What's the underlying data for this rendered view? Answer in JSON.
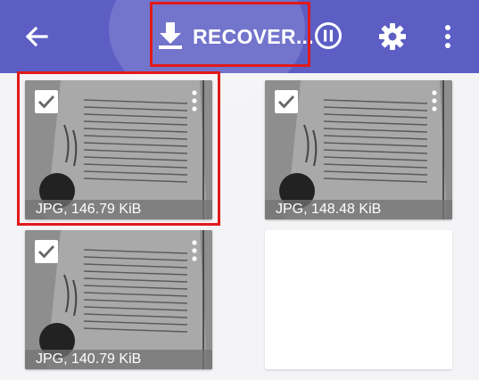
{
  "toolbar": {
    "recover_label": "RECOVER...",
    "icons": [
      "back-arrow-icon",
      "download-icon",
      "pause-icon",
      "settings-gear-icon",
      "more-vert-icon"
    ],
    "colors": {
      "background": "#5c5ec4",
      "highlight": "#e01a1a"
    }
  },
  "files": [
    {
      "caption": "JPG, 146.79 KiB",
      "selected": true
    },
    {
      "caption": "JPG, 148.48 KiB",
      "selected": true
    },
    {
      "caption": "JPG, 140.79 KiB",
      "selected": true
    },
    {
      "caption": "",
      "selected": false
    }
  ]
}
